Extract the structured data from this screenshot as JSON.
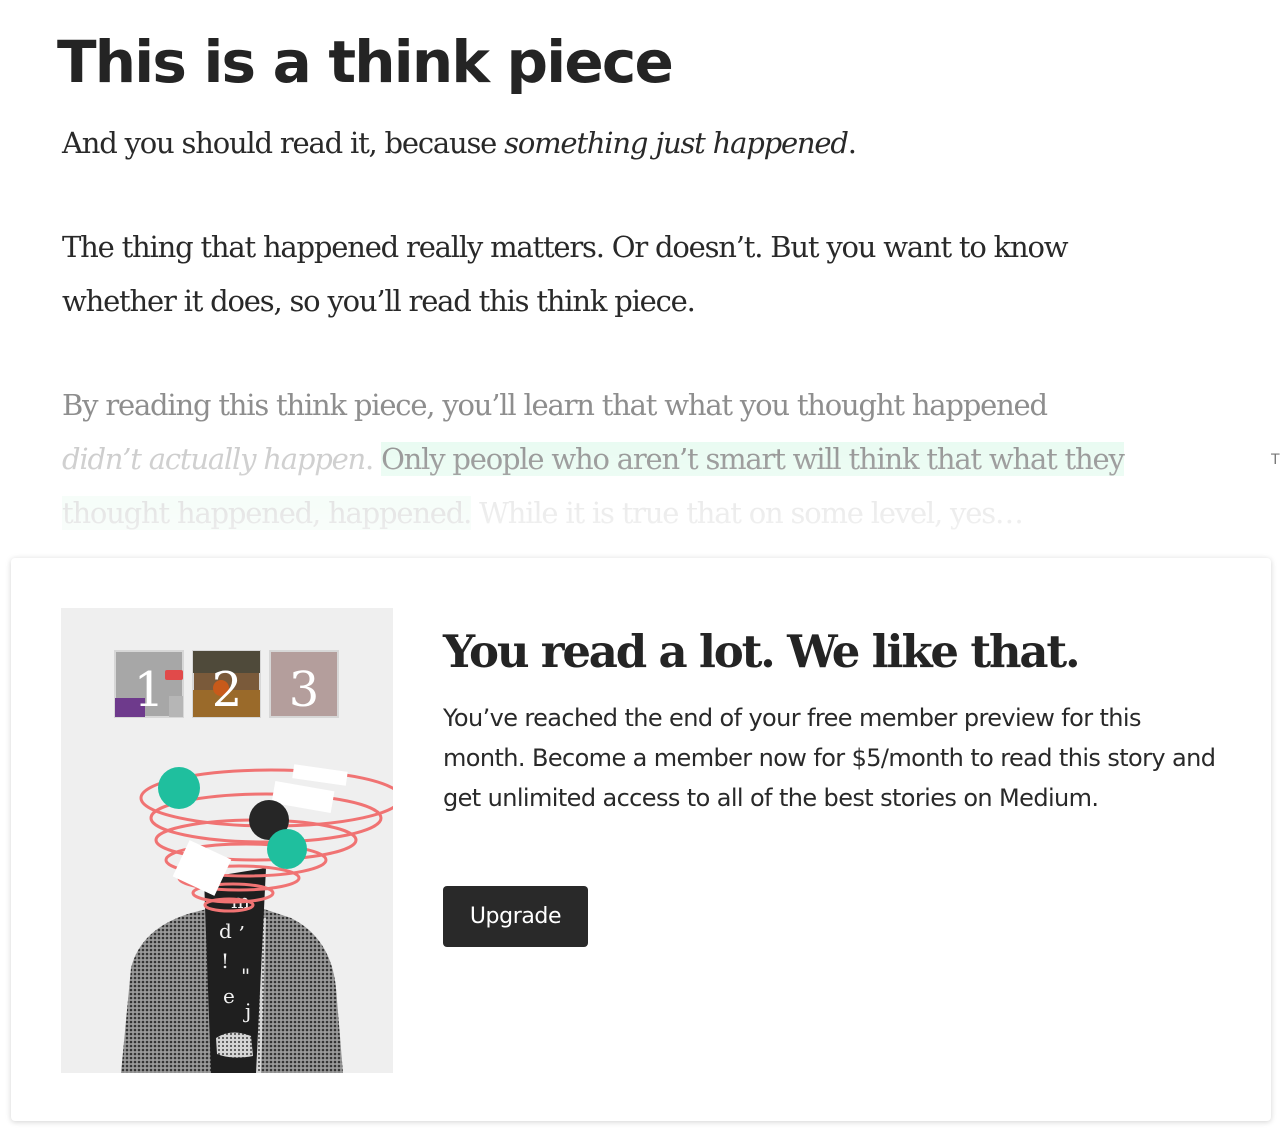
{
  "article": {
    "title": "This is a think piece",
    "p1": {
      "text": "And you should read it, because ",
      "em": "something just happened",
      "end": "."
    },
    "p2": {
      "line1": "The thing that happened really matters. Or doesn’t. But you want to know",
      "line2": "whether it does, so you’ll read this think piece."
    },
    "p3": {
      "line1": "By reading this think piece, you’ll learn that what you thought happened",
      "line2_em": "didn’t actually happen",
      "line2_sep": ". ",
      "line2_highlight": "Only people who aren’t smart will think that what they",
      "line3_highlight": "thought happened, happened.",
      "line3_rest": " While it is true that on some level, yes…"
    },
    "side_glyph": "T"
  },
  "paywall": {
    "heading": "You read a lot. We like that.",
    "body": "You’ve reached the end of your free member preview for this month. Become a member now for $5/month to read this story and get unlimited access to all of the best stories on Medium.",
    "upgrade_label": "Upgrade",
    "illustration": {
      "numbers": [
        "1",
        "2",
        "3"
      ],
      "accent_color": "#1fbf9e",
      "swirl_color": "#f07373"
    }
  }
}
